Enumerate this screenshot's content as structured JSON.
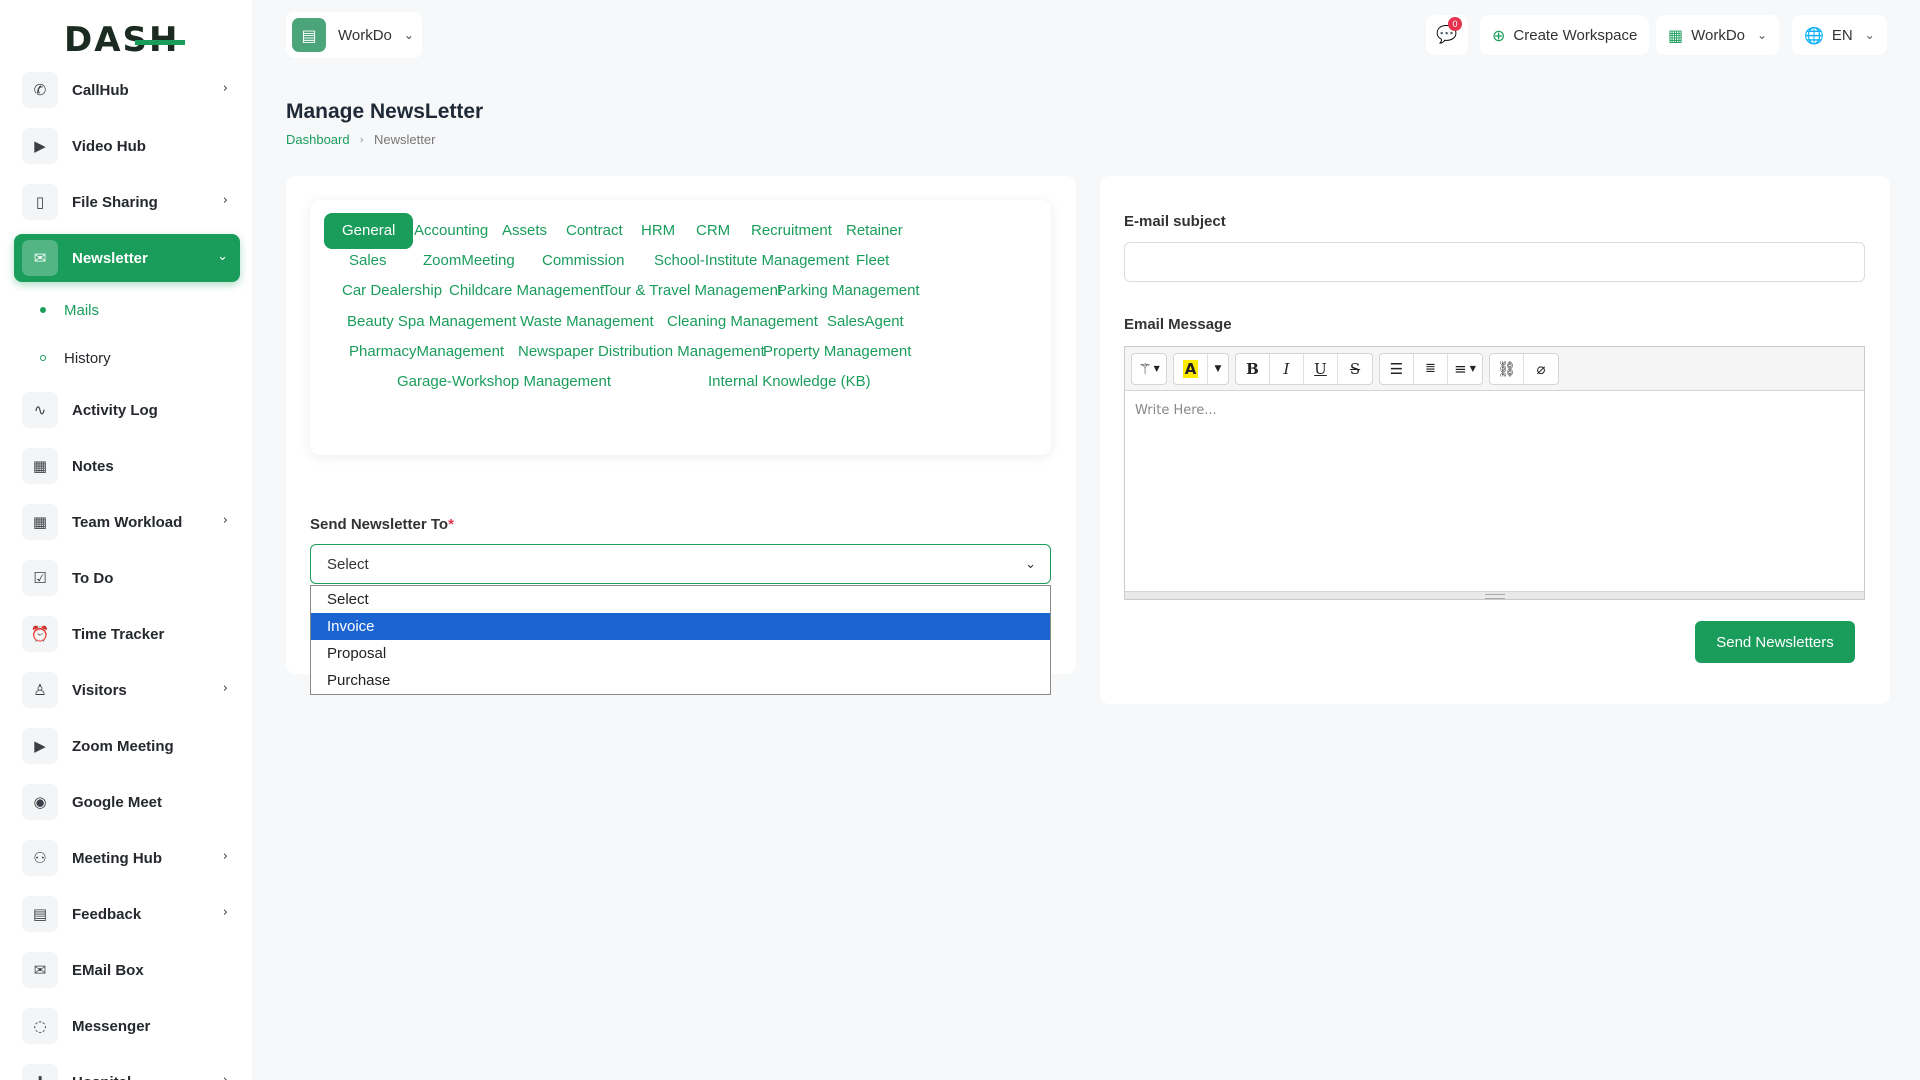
{
  "brand": {
    "logo": "DASH"
  },
  "sidebar": {
    "items": [
      {
        "label": "CallHub",
        "icon": "phone-icon",
        "chevron": true
      },
      {
        "label": "Video Hub",
        "icon": "video-icon",
        "chevron": false
      },
      {
        "label": "File Sharing",
        "icon": "file-icon",
        "chevron": true
      },
      {
        "label": "Newsletter",
        "icon": "mail-icon",
        "chevron": true,
        "active": true
      },
      {
        "label": "Activity Log",
        "icon": "activity-icon",
        "chevron": false
      },
      {
        "label": "Notes",
        "icon": "calendar-icon",
        "chevron": false
      },
      {
        "label": "Team Workload",
        "icon": "calendar-icon",
        "chevron": true
      },
      {
        "label": "To Do",
        "icon": "checkbox-icon",
        "chevron": false
      },
      {
        "label": "Time Tracker",
        "icon": "alarm-icon",
        "chevron": false
      },
      {
        "label": "Visitors",
        "icon": "person-icon",
        "chevron": true
      },
      {
        "label": "Zoom Meeting",
        "icon": "video-icon",
        "chevron": false
      },
      {
        "label": "Google Meet",
        "icon": "webcam-icon",
        "chevron": false
      },
      {
        "label": "Meeting Hub",
        "icon": "users-icon",
        "chevron": true
      },
      {
        "label": "Feedback",
        "icon": "clipboard-icon",
        "chevron": true
      },
      {
        "label": "EMail Box",
        "icon": "mail-icon",
        "chevron": false
      },
      {
        "label": "Messenger",
        "icon": "chat-icon",
        "chevron": false
      },
      {
        "label": "Hospital",
        "icon": "hospital-icon",
        "chevron": true
      }
    ],
    "newsletter_sub": [
      {
        "label": "Mails",
        "active": true
      },
      {
        "label": "History",
        "active": false
      }
    ]
  },
  "header": {
    "workspace": "WorkDo",
    "message_badge": "0",
    "create_workspace": "Create Workspace",
    "workspace_switch": "WorkDo",
    "language": "EN"
  },
  "page": {
    "title": "Manage NewsLetter",
    "breadcrumb": [
      "Dashboard",
      "Newsletter"
    ]
  },
  "modules": [
    "General",
    "Accounting",
    "Assets",
    "Contract",
    "HRM",
    "CRM",
    "Recruitment",
    "Retainer",
    "Sales",
    "ZoomMeeting",
    "Commission",
    "School-Institute Management",
    "Fleet",
    "Car Dealership",
    "Childcare Management",
    "Tour & Travel Management",
    "Parking Management",
    "Beauty Spa Management",
    "Waste Management",
    "Cleaning Management",
    "SalesAgent",
    "PharmacyManagement",
    "Newspaper Distribution Management",
    "Property Management",
    "Garage-Workshop Management",
    "Internal Knowledge (KB)"
  ],
  "active_module": "General",
  "send_to": {
    "label": "Send Newsletter To",
    "required_mark": "*",
    "value": "Select",
    "options": [
      "Select",
      "Invoice",
      "Proposal",
      "Purchase"
    ],
    "highlighted": "Invoice"
  },
  "email": {
    "subject_label": "E-mail subject",
    "subject_value": "",
    "message_label": "Email Message",
    "message_placeholder": "Write Here...",
    "send_button": "Send Newsletters"
  },
  "colors": {
    "accent": "#1a9d5b",
    "badge": "#e5334f",
    "highlight": "#1a64d2"
  }
}
